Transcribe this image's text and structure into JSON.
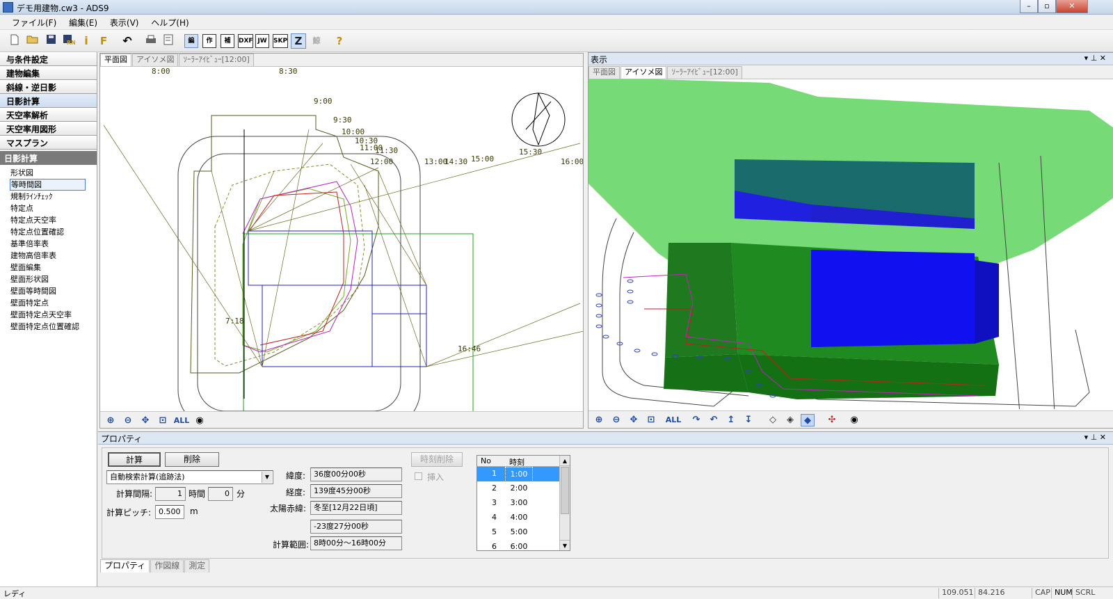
{
  "window": {
    "title": "デモ用建物.cw3 - ADS9",
    "min": "–",
    "restore": "▫",
    "close": "✕"
  },
  "menu": [
    "ファイル(F)",
    "編集(E)",
    "表示(V)",
    "ヘルプ(H)"
  ],
  "toolbar": {
    "mode_edit": "編",
    "mode_draw": "作",
    "mode_aux": "補",
    "dxf": "DXF",
    "jw": "JW",
    "skp": "SKP",
    "z": "Z",
    "lock": "鯨",
    "help": "?"
  },
  "nav": [
    "与条件設定",
    "建物編集",
    "斜線・逆日影",
    "日影計算",
    "天空率解析",
    "天空率用図形",
    "マスプラン"
  ],
  "section_title": "日影計算",
  "subitems": [
    "形状図",
    "等時間図",
    "規制ﾗｲﾝﾁｪｯｸ",
    "特定点",
    "特定点天空率",
    "特定点位置確認",
    "基準倍率表",
    "建物高倍率表",
    "壁面編集",
    "壁面形状図",
    "壁面等時間図",
    "壁面特定点",
    "壁面特定点天空率",
    "壁面特定点位置確認"
  ],
  "left_view": {
    "tabs": [
      "平面図",
      "アイソメ図",
      "ｿｰﾗｰｱｲﾋﾞｭｰ[12:00]"
    ],
    "time_labels": [
      "8:00",
      "8:30",
      "9:00",
      "9:30",
      "10:00",
      "10:30",
      "11:00",
      "11:30",
      "12:00",
      "13:00",
      "14:30",
      "15:00",
      "15:30",
      "16:00",
      "7:18",
      "16:46"
    ],
    "all": "ALL"
  },
  "right_view": {
    "header": "表示",
    "tabs": [
      "平面図",
      "アイソメ図",
      "ｿｰﾗｰｱｲﾋﾞｭｰ[12:00]"
    ],
    "all": "ALL",
    "pin": "▾ ⊥ ✕"
  },
  "props": {
    "header": "プロパティ",
    "calc_btn": "計算",
    "delete_btn": "削除",
    "method": "自動検索計算(追跡法)",
    "interval_label": "計算間隔:",
    "interval_h": "1",
    "hour_unit": "時間",
    "interval_m": "0",
    "min_unit": "分",
    "pitch_label": "計算ピッチ:",
    "pitch": "0.500",
    "pitch_unit": "m",
    "lat_label": "緯度:",
    "lat": "36度00分00秒",
    "lon_label": "経度:",
    "lon": "139度45分00秒",
    "decl_label": "太陽赤緯:",
    "decl_sel": "冬至[12月22日頃]",
    "decl_val": "-23度27分00秒",
    "range_label": "計算範囲:",
    "range": "8時00分～16時00分",
    "time_del_btn": "時刻削除",
    "insert_label": "挿入",
    "table_headers": [
      "No",
      "時刻"
    ],
    "table_rows": [
      [
        "1",
        "1:00"
      ],
      [
        "2",
        "2:00"
      ],
      [
        "3",
        "3:00"
      ],
      [
        "4",
        "4:00"
      ],
      [
        "5",
        "5:00"
      ],
      [
        "6",
        "6:00"
      ]
    ],
    "bottom_tabs": [
      "プロパティ",
      "作図線",
      "測定"
    ]
  },
  "status": {
    "ready": "レディ",
    "x": "109.051",
    "y": "84.216",
    "cap": "CAP",
    "num": "NUM",
    "scrl": "SCRL"
  }
}
